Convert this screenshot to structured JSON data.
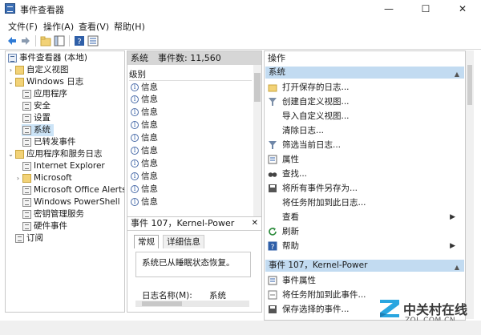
{
  "window": {
    "title": "事件查看器",
    "minimize": "—",
    "maximize": "☐",
    "close": "✕"
  },
  "menu": [
    "文件(F)",
    "操作(A)",
    "查看(V)",
    "帮助(H)"
  ],
  "tree": {
    "root": "事件查看器 (本地)",
    "custom_views": "自定义视图",
    "windows_logs": "Windows 日志",
    "win_children": [
      "应用程序",
      "安全",
      "设置",
      "系统",
      "已转发事件"
    ],
    "apps_services": "应用程序和服务日志",
    "app_children": [
      "Internet Explorer",
      "Microsoft",
      "Microsoft Office Alerts",
      "Windows PowerShell",
      "密钥管理服务",
      "硬件事件"
    ],
    "subscriptions": "订阅",
    "selected": "系统"
  },
  "events": {
    "log_name": "系统",
    "count_label": "事件数: 11,560",
    "column": "级别",
    "rows": [
      "信息",
      "信息",
      "信息",
      "信息",
      "信息",
      "信息",
      "信息",
      "信息",
      "信息",
      "信息"
    ]
  },
  "detail": {
    "header": "事件 107，Kernel-Power",
    "close": "✕",
    "tabs": [
      "常规",
      "详细信息"
    ],
    "message": "系统已从睡眠状态恢复。",
    "field_label": "日志名称(M):",
    "field_value": "系统"
  },
  "actions": {
    "title": "操作",
    "section1": "系统",
    "items1": [
      "打开保存的日志...",
      "创建自定义视图...",
      "导入自定义视图...",
      "清除日志...",
      "筛选当前日志...",
      "属性",
      "查找...",
      "将所有事件另存为...",
      "将任务附加到此日志...",
      "查看",
      "刷新",
      "帮助"
    ],
    "section2": "事件 107，Kernel-Power",
    "items2": [
      "事件属性",
      "将任务附加到此事件...",
      "保存选择的事件..."
    ]
  },
  "watermark": {
    "cn": "中关村在线",
    "en": "ZOL.COM.CN"
  }
}
